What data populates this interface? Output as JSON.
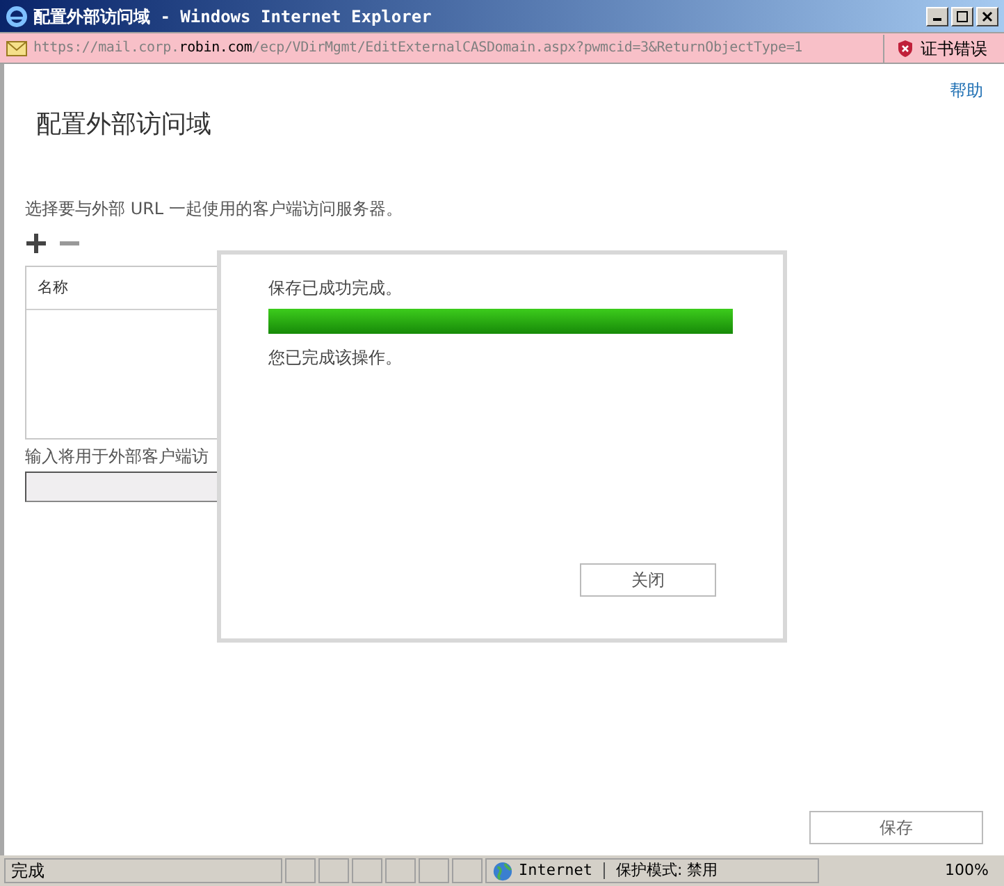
{
  "window": {
    "title": "配置外部访问域 - Windows Internet Explorer"
  },
  "address_bar": {
    "url_parts": [
      {
        "text": "https://mail.corp.",
        "highlight": false
      },
      {
        "text": "robin.com",
        "highlight": true
      },
      {
        "text": "/ecp/VDirMgmt/EditExternalCASDomain.aspx?pwmcid=3&ReturnObjectType=1",
        "highlight": false
      }
    ],
    "certificate_error": "证书错误"
  },
  "page": {
    "help_link": "帮助",
    "title": "配置外部访问域",
    "instruction": "选择要与外部 URL 一起使用的客户端访问服务器。",
    "table": {
      "columns": [
        "名称"
      ]
    },
    "input_label": "输入将用于外部客户端访",
    "save_button": "保存"
  },
  "dialog": {
    "message": "保存已成功完成。",
    "progress": {
      "level": 1
    },
    "result": "您已完成该操作。",
    "close_button": "关闭"
  },
  "status_bar": {
    "status": "完成",
    "zone": "Internet",
    "protected_mode": "保护模式: 禁用",
    "zoom": "100%"
  }
}
